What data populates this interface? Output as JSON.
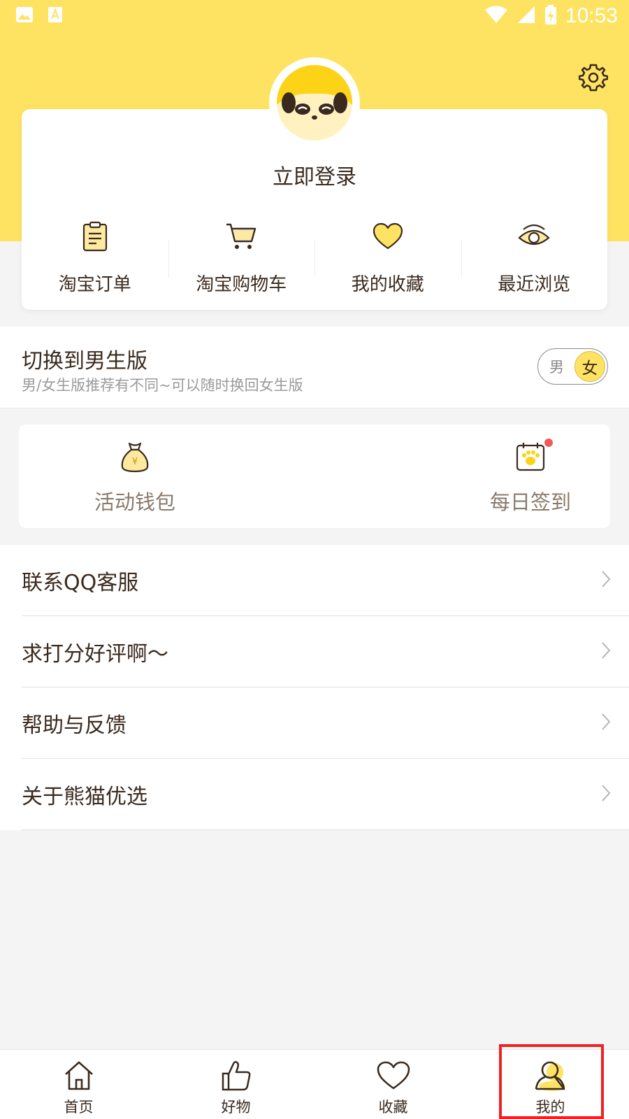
{
  "status_bar": {
    "time": "10:53",
    "icons": [
      "image-icon",
      "app-store-icon",
      "wifi-icon",
      "signal-icon",
      "battery-charging-icon"
    ]
  },
  "header": {
    "avatar_icon": "panda-avatar-icon",
    "login_label": "立即登录",
    "settings_icon": "gear-icon",
    "background_color": "#fee363"
  },
  "quick_links": [
    {
      "label": "淘宝订单",
      "icon": "clipboard-icon"
    },
    {
      "label": "淘宝购物车",
      "icon": "cart-icon"
    },
    {
      "label": "我的收藏",
      "icon": "heart-icon"
    },
    {
      "label": "最近浏览",
      "icon": "eye-icon"
    }
  ],
  "gender_switch": {
    "title": "切换到男生版",
    "subtitle": "男/女生版推荐有不同~可以随时换回女生版",
    "off_label": "男",
    "on_label": "女"
  },
  "wallet": [
    {
      "label": "活动钱包",
      "icon": "money-bag-icon"
    },
    {
      "label": "每日签到",
      "icon": "calendar-paw-icon",
      "badge": "red-dot"
    }
  ],
  "menu": [
    {
      "label": "联系QQ客服"
    },
    {
      "label": "求打分好评啊～"
    },
    {
      "label": "帮助与反馈"
    },
    {
      "label": "关于熊猫优选"
    }
  ],
  "bottom_nav": [
    {
      "label": "首页",
      "icon": "home-icon"
    },
    {
      "label": "好物",
      "icon": "thumbs-up-icon"
    },
    {
      "label": "收藏",
      "icon": "heart-outline-icon"
    },
    {
      "label": "我的",
      "icon": "user-icon",
      "selected": true
    }
  ],
  "colors": {
    "accent": "#fee363",
    "text": "#3a2a1e",
    "highlight_box": "#ee2222",
    "badge": "#f25a5a"
  }
}
